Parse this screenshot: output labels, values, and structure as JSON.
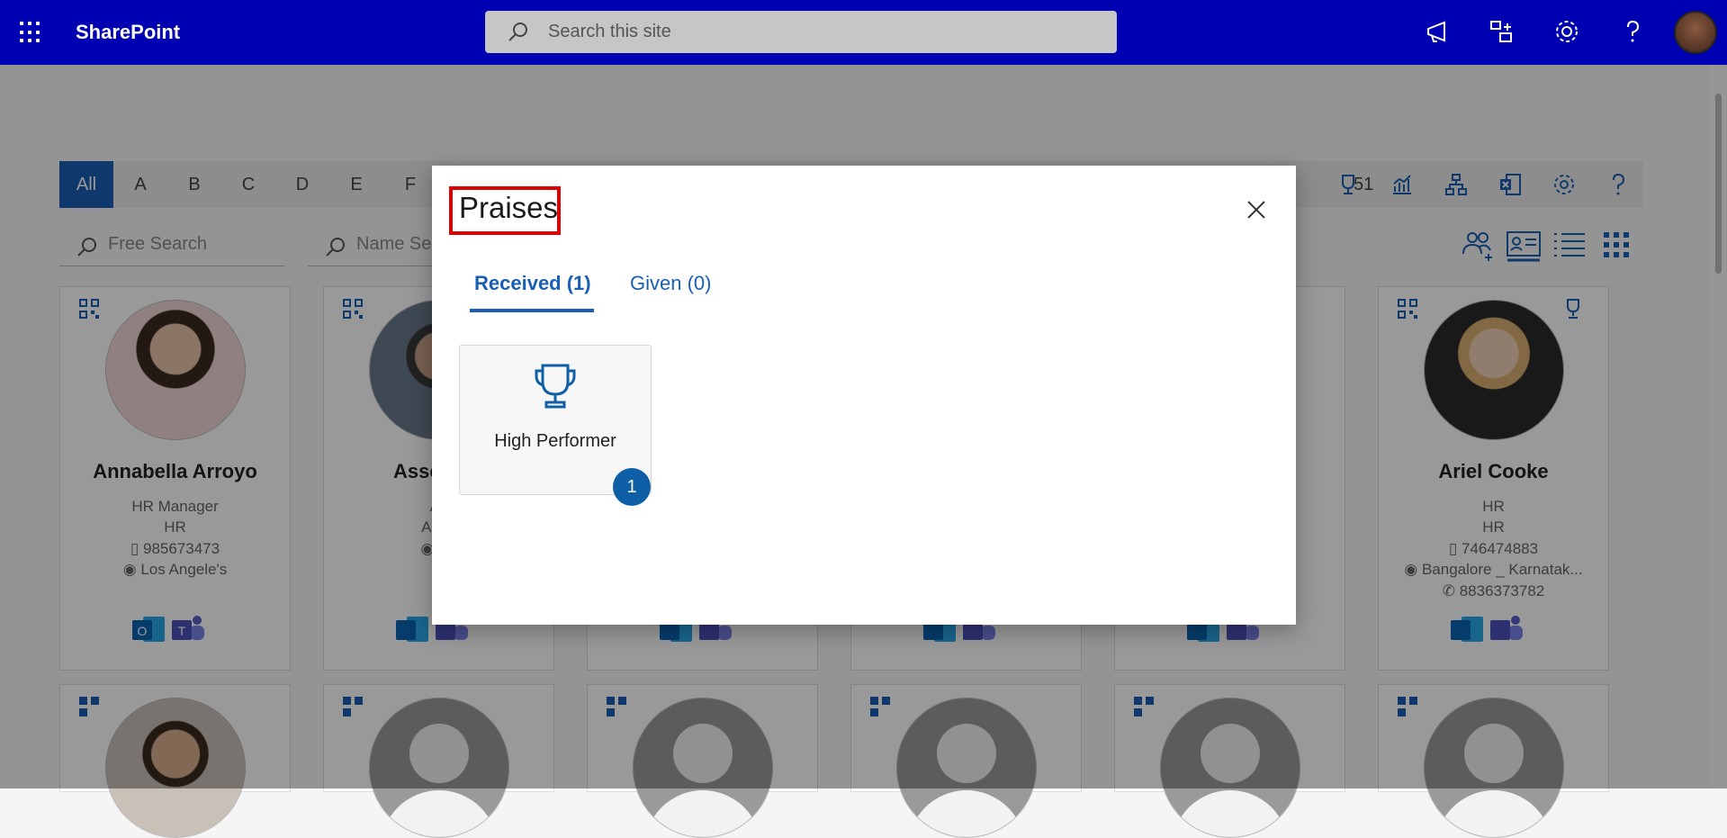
{
  "header": {
    "brand": "SharePoint",
    "search_placeholder": "Search this site",
    "icons": [
      "waffle-icon",
      "megaphone-icon",
      "share-icon",
      "gear-icon",
      "help-icon",
      "avatar"
    ],
    "color": "#0000b3"
  },
  "alpha": {
    "letters": [
      "All",
      "A",
      "B",
      "C",
      "D",
      "E",
      "F"
    ],
    "active": "All",
    "count": "51",
    "tool_icons": [
      "trophy-icon",
      "chart-icon",
      "org-chart-icon",
      "excel-icon",
      "gear-icon",
      "help-icon"
    ]
  },
  "filters": {
    "free_search_placeholder": "Free Search",
    "name_search_placeholder": "Name Se"
  },
  "view_icons": [
    "people-add-icon",
    "contact-card-icon",
    "list-icon",
    "grid-icon"
  ],
  "cards": {
    "c1": {
      "name": "Annabella Arroyo",
      "title": "HR Manager",
      "dept": "HR",
      "mobile": "985673473",
      "location": "Los Angele's"
    },
    "c2": {
      "name": "AssetTAb",
      "title": "Ac",
      "dept": "Admi",
      "location": "Ba"
    },
    "c6": {
      "name": "Ariel Cooke",
      "title": "HR",
      "dept": "HR",
      "mobile": "746474883",
      "location": "Bangalore _ Karnatak...",
      "phone": "8836373782"
    }
  },
  "modal": {
    "title": "Praises",
    "tabs": [
      {
        "label": "Received (1)",
        "active": true
      },
      {
        "label": "Given (0)",
        "active": false
      }
    ],
    "praise": {
      "label": "High Performer",
      "count": "1",
      "icon": "trophy-icon"
    }
  },
  "colors": {
    "accent": "#1a5fb4",
    "badge": "#0f5fa6",
    "highlight": "#e00000"
  }
}
